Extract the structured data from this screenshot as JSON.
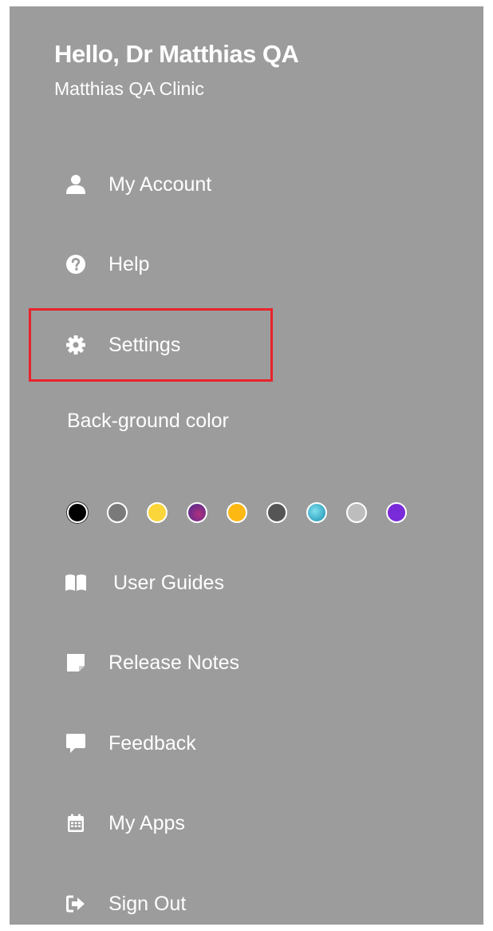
{
  "header": {
    "greeting": "Hello, Dr Matthias QA",
    "clinic": "Matthias QA Clinic"
  },
  "menu": {
    "my_account": {
      "label": "My Account",
      "icon": "user-icon"
    },
    "help": {
      "label": "Help",
      "icon": "question-circle-icon"
    },
    "settings": {
      "label": "Settings",
      "icon": "gear-icon"
    },
    "user_guides": {
      "label": "User Guides",
      "icon": "book-open-icon"
    },
    "release_notes": {
      "label": "Release Notes",
      "icon": "sticky-note-icon"
    },
    "feedback": {
      "label": "Feedback",
      "icon": "comment-icon"
    },
    "my_apps": {
      "label": "My Apps",
      "icon": "calendar-icon"
    },
    "sign_out": {
      "label": "Sign Out",
      "icon": "sign-out-icon"
    }
  },
  "background_color": {
    "label": "Back-ground color",
    "swatches": [
      {
        "color": "#000000",
        "selected": true
      },
      {
        "color": "#7a7a7a"
      },
      {
        "color": "#fbd63a"
      },
      {
        "color": "#7b2f8f"
      },
      {
        "color": "#fdb813"
      },
      {
        "color": "#555555"
      },
      {
        "color": "#29b6c9"
      },
      {
        "color": "#bdbdbd"
      },
      {
        "color": "#7a2bd9"
      }
    ]
  },
  "colors": {
    "panel_bg": "#9c9c9c",
    "text": "#ffffff",
    "highlight": "#e8232b"
  }
}
